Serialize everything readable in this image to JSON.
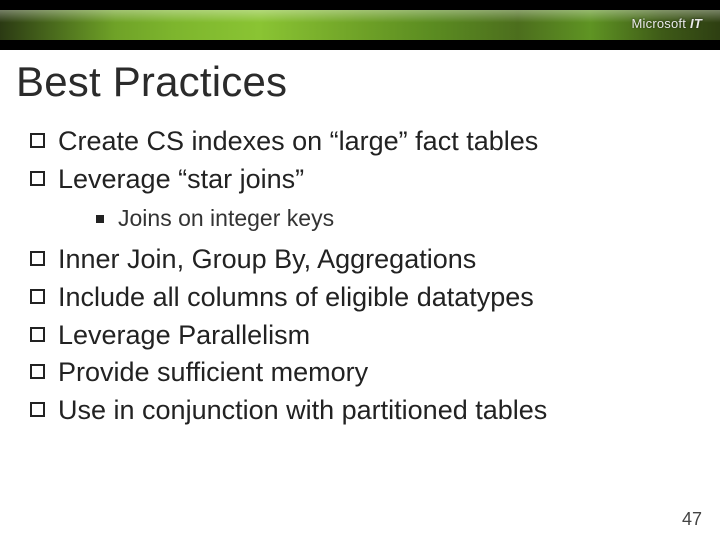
{
  "brand": {
    "name": "Microsoft",
    "suffix": "IT"
  },
  "title": "Best Practices",
  "bullets": [
    {
      "text": "Create CS indexes on “large” fact tables"
    },
    {
      "text": "Leverage “star joins”",
      "children": [
        {
          "text": "Joins on integer keys"
        }
      ]
    },
    {
      "text": "Inner Join, Group By, Aggregations"
    },
    {
      "text": "Include all columns of eligible datatypes"
    },
    {
      "text": "Leverage Parallelism"
    },
    {
      "text": "Provide sufficient memory"
    },
    {
      "text": "Use in conjunction with partitioned tables"
    }
  ],
  "page_number": "47"
}
